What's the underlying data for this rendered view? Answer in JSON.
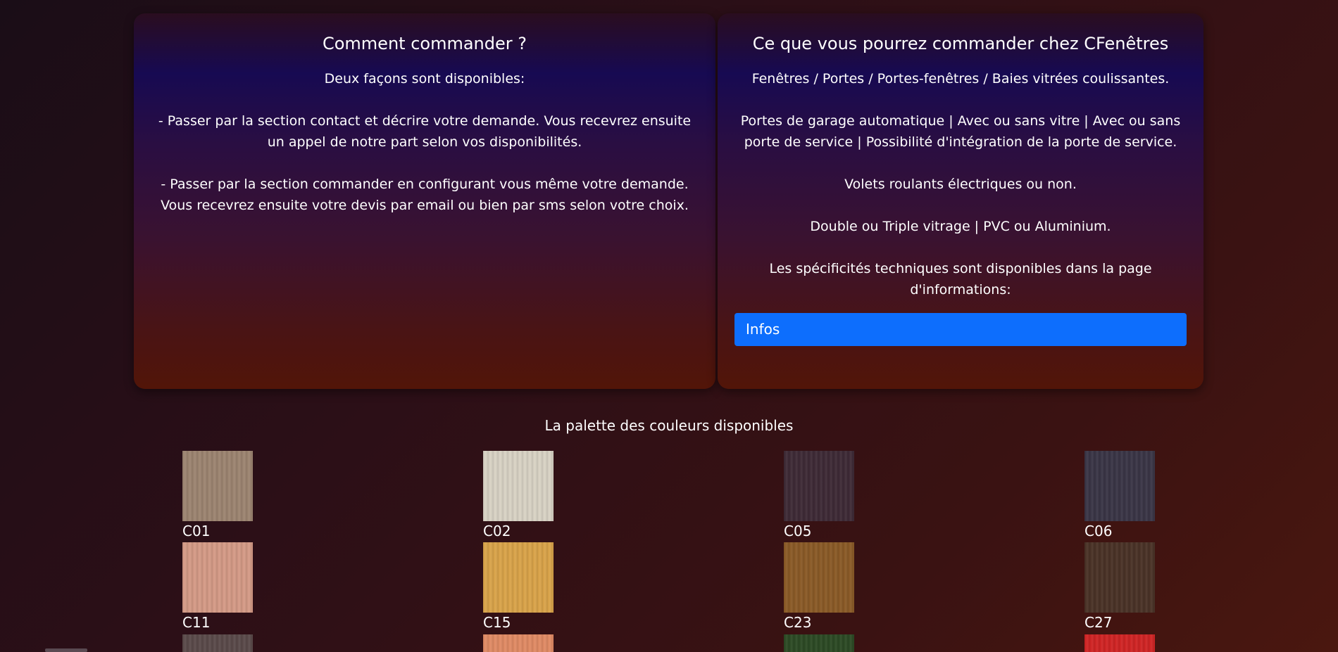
{
  "order": {
    "title": "Comment commander ?",
    "paragraphs": [
      "Deux façons sont disponibles:",
      "- Passer par la section contact et décrire votre demande. Vous recevrez ensuite un appel de notre part selon vos disponibilités.",
      "- Passer par la section commander en configurant vous même votre demande. Vous recevrez ensuite votre devis par email ou bien par sms selon votre choix."
    ]
  },
  "catalog": {
    "title": "Ce que vous pourrez commander chez CFenêtres",
    "paragraphs": [
      "Fenêtres / Portes / Portes-fenêtres / Baies vitrées coulissantes.",
      "Portes de garage automatique | Avec ou sans vitre | Avec ou sans porte de service | Possibilité d'intégration de la porte de service.",
      "Volets roulants électriques ou non.",
      "Double ou Triple vitrage | PVC ou Aluminium.",
      "Les spécificités techniques sont disponibles dans la page d'informations:"
    ],
    "button_label": "Infos",
    "button_color": "#0d6efd"
  },
  "palette": {
    "title": "La palette des couleurs disponibles",
    "swatches": [
      {
        "code": "C01",
        "color": "#9c8470"
      },
      {
        "code": "C02",
        "color": "#d8d2c4"
      },
      {
        "code": "C05",
        "color": "#3e2a36"
      },
      {
        "code": "C06",
        "color": "#3a3546"
      },
      {
        "code": "C11",
        "color": "#d49a86"
      },
      {
        "code": "C15",
        "color": "#d9a349"
      },
      {
        "code": "C23",
        "color": "#8a5a26"
      },
      {
        "code": "C27",
        "color": "#4a3226"
      }
    ],
    "partial_row_colors": [
      "#5a4a4a",
      "#e08a64",
      "#2c4a24",
      "#d02424"
    ]
  }
}
